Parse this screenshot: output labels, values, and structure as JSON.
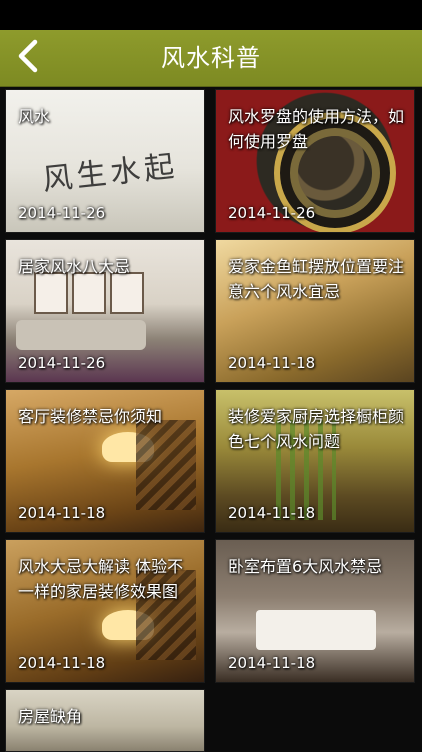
{
  "header": {
    "title": "风水科普",
    "back_icon": "chevron-left-icon",
    "bar_color": "#8a972a"
  },
  "articles": [
    {
      "title": "风水",
      "date": "2014-11-26",
      "image_text": "风生水起"
    },
    {
      "title": "风水罗盘的使用方法，如何使用罗盘",
      "date": "2014-11-26"
    },
    {
      "title": "居家风水八大忌",
      "date": "2014-11-26"
    },
    {
      "title": "爱家金鱼缸摆放位置要注意六个风水宜忌",
      "date": "2014-11-18"
    },
    {
      "title": "客厅装修禁忌你须知",
      "date": "2014-11-18"
    },
    {
      "title": "装修爱家厨房选择橱柜颜色七个风水问题",
      "date": "2014-11-18"
    },
    {
      "title": "风水大忌大解读 体验不一样的家居装修效果图",
      "date": "2014-11-18"
    },
    {
      "title": "卧室布置6大风水禁忌",
      "date": "2014-11-18"
    },
    {
      "title": "房屋缺角",
      "date": ""
    }
  ]
}
